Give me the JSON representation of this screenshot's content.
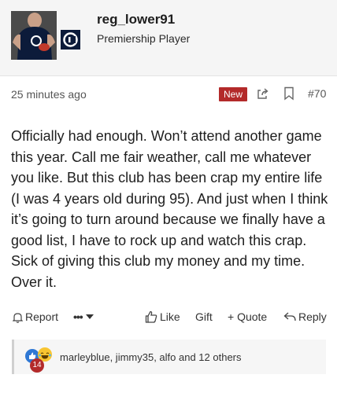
{
  "author": {
    "username": "reg_lower91",
    "title": "Premiership Player"
  },
  "post": {
    "timestamp": "25 minutes ago",
    "badge": "New",
    "number": "#70",
    "body": "Officially had enough. Won’t attend another game this year. Call me fair weather, call me whatever you like. But this club has been crap my entire life (I was 4 years old during 95). And just when I think it’s going to turn around because we finally have a good list, I have to rock up and watch this crap. Sick of giving this club my money and my time. Over it."
  },
  "actions": {
    "report": "Report",
    "more": "•••",
    "like": "Like",
    "gift": "Gift",
    "quote": "+ Quote",
    "reply": "Reply"
  },
  "reactions": {
    "count": "14",
    "users": "marleyblue, jimmy35, alfo and 12 others"
  },
  "colors": {
    "new_badge": "#b32a2a",
    "like_reaction": "#2f78d4",
    "laugh_reaction": "#f8c531"
  }
}
